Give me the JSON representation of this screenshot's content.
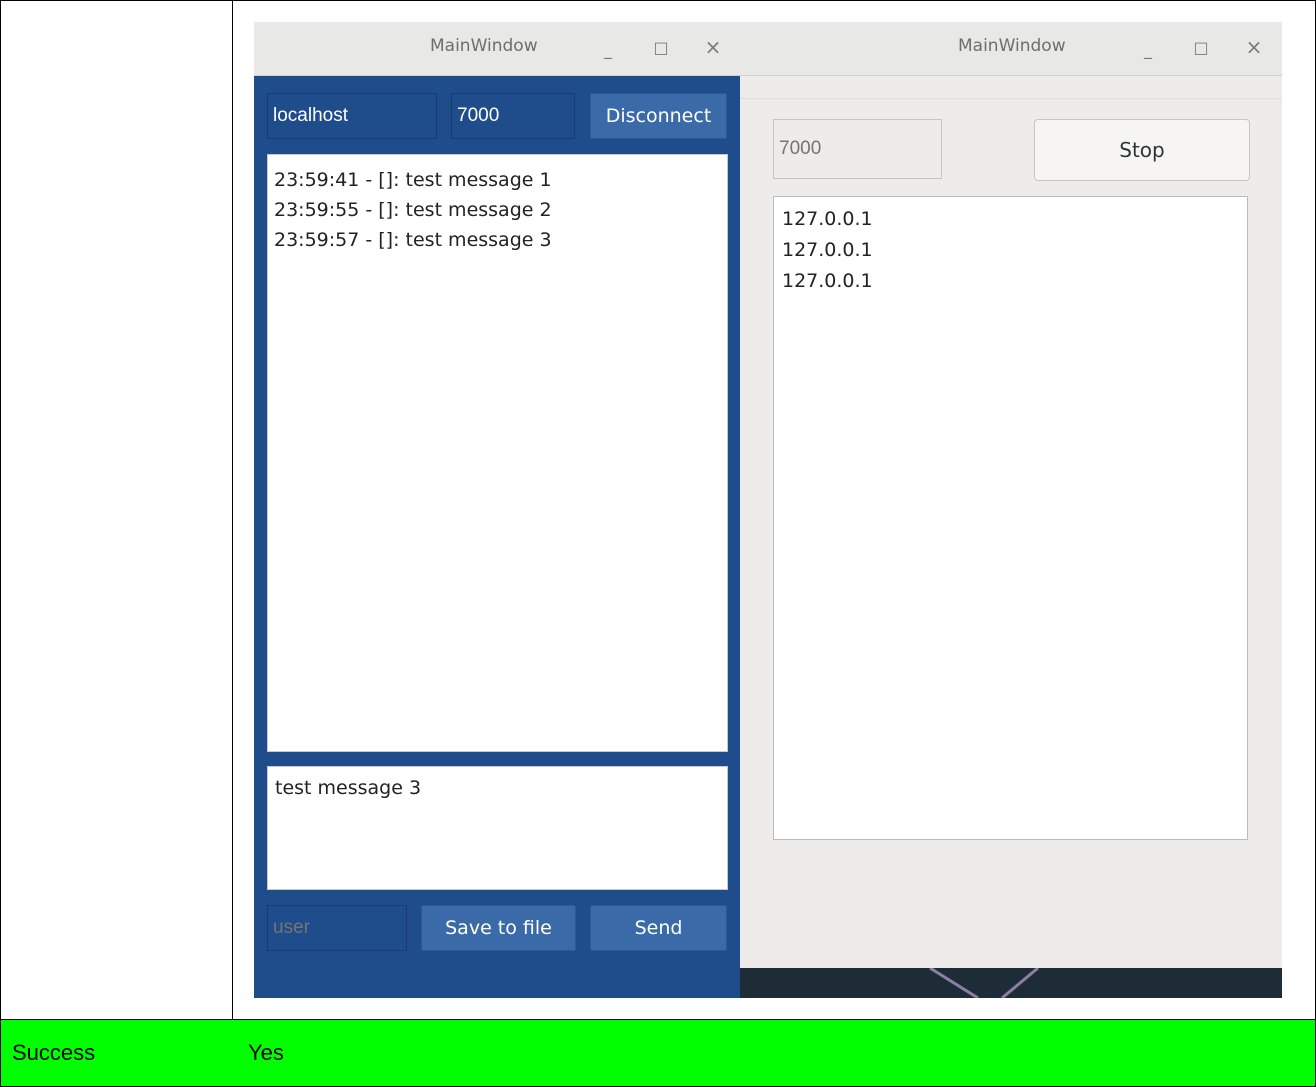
{
  "client_window": {
    "title": "MainWindow",
    "controls": {
      "minimize": "_",
      "maximize": "□",
      "close": "×"
    },
    "host_value": "localhost",
    "port_value": "7000",
    "disconnect_label": "Disconnect",
    "messages": [
      "23:59:41 - []: test message 1",
      "23:59:55 - []: test message 2",
      "23:59:57 - []: test message 3"
    ],
    "compose_text": "test message 3",
    "user_placeholder": "user",
    "save_label": "Save to file",
    "send_label": "Send"
  },
  "server_window": {
    "title": "MainWindow",
    "controls": {
      "minimize": "_",
      "maximize": "□",
      "close": "×"
    },
    "port_placeholder": "7000",
    "stop_label": "Stop",
    "clients": [
      "127.0.0.1",
      "127.0.0.1",
      "127.0.0.1"
    ]
  },
  "result": {
    "label": "Success",
    "value": "Yes"
  },
  "colors": {
    "client_bg": "#1f4c8b",
    "server_bg": "#edecea",
    "success_row": "#00ff00"
  }
}
